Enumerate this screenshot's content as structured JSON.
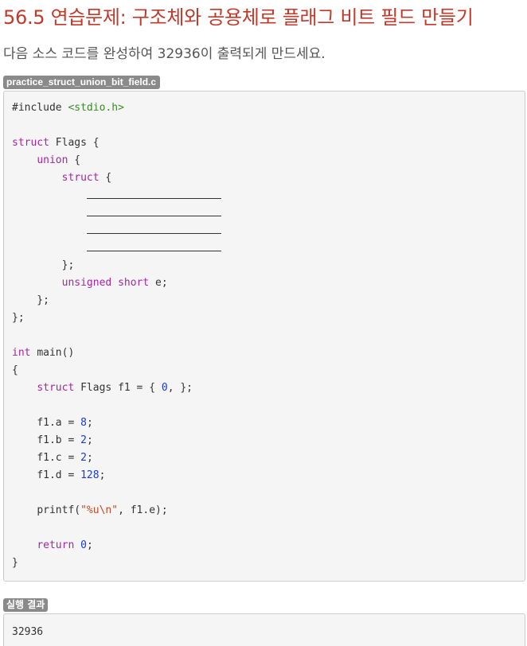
{
  "title": "56.5 연습문제: 구조체와 공용체로 플래그 비트 필드 만들기",
  "description": "다음 소스 코드를 완성하여 32936이 출력되게 만드세요.",
  "file_label": "practice_struct_union_bit_field.c",
  "code": {
    "include_directive": "#include",
    "include_header": "<stdio.h>",
    "kw_struct": "struct",
    "kw_union": "union",
    "kw_unsigned": "unsigned",
    "kw_short": "short",
    "kw_int": "int",
    "kw_return": "return",
    "type_name": "Flags",
    "member_e": "e",
    "main_sig": "main()",
    "var_f1": "f1",
    "init_zero": "0",
    "assign_a_lhs": "f1.a",
    "assign_a_val": "8",
    "assign_b_lhs": "f1.b",
    "assign_b_val": "2",
    "assign_c_lhs": "f1.c",
    "assign_c_val": "2",
    "assign_d_lhs": "f1.d",
    "assign_d_val": "128",
    "printf_fn": "printf",
    "printf_fmt": "\"%u\\n\"",
    "printf_arg": "f1.e",
    "return_val": "0"
  },
  "result_label": "실행 결과",
  "result_output": "32936"
}
